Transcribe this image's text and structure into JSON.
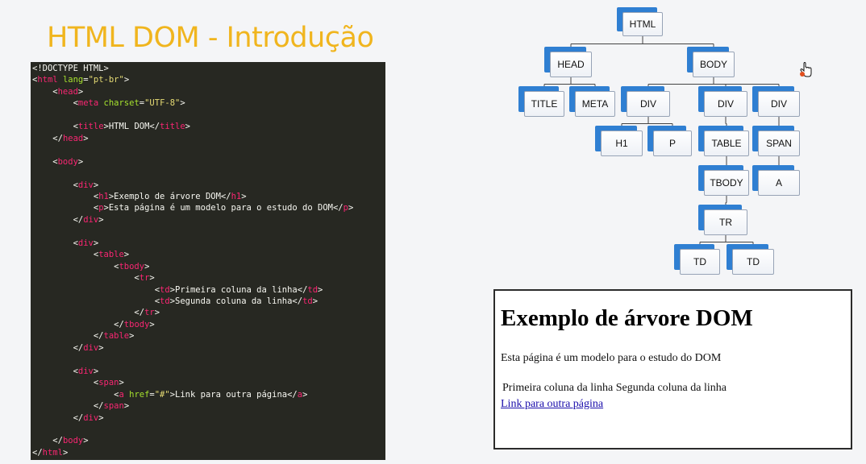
{
  "title": "HTML DOM - Introdução",
  "code": {
    "lines": [
      [
        {
          "c": "p",
          "t": "<!DOCTYPE HTML>"
        }
      ],
      [
        {
          "c": "p",
          "t": "<"
        },
        {
          "c": "t",
          "t": "html"
        },
        {
          "c": "a",
          "t": " lang"
        },
        {
          "c": "p",
          "t": "="
        },
        {
          "c": "s",
          "t": "\"pt-br\""
        },
        {
          "c": "p",
          "t": ">"
        }
      ],
      [
        {
          "c": "p",
          "t": "    <"
        },
        {
          "c": "t",
          "t": "head"
        },
        {
          "c": "p",
          "t": ">"
        }
      ],
      [
        {
          "c": "p",
          "t": "        <"
        },
        {
          "c": "t",
          "t": "meta"
        },
        {
          "c": "a",
          "t": " charset"
        },
        {
          "c": "p",
          "t": "="
        },
        {
          "c": "s",
          "t": "\"UTF-8\""
        },
        {
          "c": "p",
          "t": ">"
        }
      ],
      [],
      [
        {
          "c": "p",
          "t": "        <"
        },
        {
          "c": "t",
          "t": "title"
        },
        {
          "c": "p",
          "t": ">HTML DOM</"
        },
        {
          "c": "t",
          "t": "title"
        },
        {
          "c": "p",
          "t": ">"
        }
      ],
      [
        {
          "c": "p",
          "t": "    </"
        },
        {
          "c": "t",
          "t": "head"
        },
        {
          "c": "p",
          "t": ">"
        }
      ],
      [],
      [
        {
          "c": "p",
          "t": "    <"
        },
        {
          "c": "t",
          "t": "body"
        },
        {
          "c": "p",
          "t": ">"
        }
      ],
      [],
      [
        {
          "c": "p",
          "t": "        <"
        },
        {
          "c": "t",
          "t": "div"
        },
        {
          "c": "p",
          "t": ">"
        }
      ],
      [
        {
          "c": "p",
          "t": "            <"
        },
        {
          "c": "t",
          "t": "h1"
        },
        {
          "c": "p",
          "t": ">Exemplo de árvore DOM</"
        },
        {
          "c": "t",
          "t": "h1"
        },
        {
          "c": "p",
          "t": ">"
        }
      ],
      [
        {
          "c": "p",
          "t": "            <"
        },
        {
          "c": "t",
          "t": "p"
        },
        {
          "c": "p",
          "t": ">Esta página é um modelo para o estudo do DOM</"
        },
        {
          "c": "t",
          "t": "p"
        },
        {
          "c": "p",
          "t": ">"
        }
      ],
      [
        {
          "c": "p",
          "t": "        </"
        },
        {
          "c": "t",
          "t": "div"
        },
        {
          "c": "p",
          "t": ">"
        }
      ],
      [],
      [
        {
          "c": "p",
          "t": "        <"
        },
        {
          "c": "t",
          "t": "div"
        },
        {
          "c": "p",
          "t": ">"
        }
      ],
      [
        {
          "c": "p",
          "t": "            <"
        },
        {
          "c": "t",
          "t": "table"
        },
        {
          "c": "p",
          "t": ">"
        }
      ],
      [
        {
          "c": "p",
          "t": "                <"
        },
        {
          "c": "t",
          "t": "tbody"
        },
        {
          "c": "p",
          "t": ">"
        }
      ],
      [
        {
          "c": "p",
          "t": "                    <"
        },
        {
          "c": "t",
          "t": "tr"
        },
        {
          "c": "p",
          "t": ">"
        }
      ],
      [
        {
          "c": "p",
          "t": "                        <"
        },
        {
          "c": "t",
          "t": "td"
        },
        {
          "c": "p",
          "t": ">Primeira coluna da linha</"
        },
        {
          "c": "t",
          "t": "td"
        },
        {
          "c": "p",
          "t": ">"
        }
      ],
      [
        {
          "c": "p",
          "t": "                        <"
        },
        {
          "c": "t",
          "t": "td"
        },
        {
          "c": "p",
          "t": ">Segunda coluna da linha</"
        },
        {
          "c": "t",
          "t": "td"
        },
        {
          "c": "p",
          "t": ">"
        }
      ],
      [
        {
          "c": "p",
          "t": "                    </"
        },
        {
          "c": "t",
          "t": "tr"
        },
        {
          "c": "p",
          "t": ">"
        }
      ],
      [
        {
          "c": "p",
          "t": "                </"
        },
        {
          "c": "t",
          "t": "tbody"
        },
        {
          "c": "p",
          "t": ">"
        }
      ],
      [
        {
          "c": "p",
          "t": "            </"
        },
        {
          "c": "t",
          "t": "table"
        },
        {
          "c": "p",
          "t": ">"
        }
      ],
      [
        {
          "c": "p",
          "t": "        </"
        },
        {
          "c": "t",
          "t": "div"
        },
        {
          "c": "p",
          "t": ">"
        }
      ],
      [],
      [
        {
          "c": "p",
          "t": "        <"
        },
        {
          "c": "t",
          "t": "div"
        },
        {
          "c": "p",
          "t": ">"
        }
      ],
      [
        {
          "c": "p",
          "t": "            <"
        },
        {
          "c": "t",
          "t": "span"
        },
        {
          "c": "p",
          "t": ">"
        }
      ],
      [
        {
          "c": "p",
          "t": "                <"
        },
        {
          "c": "t",
          "t": "a"
        },
        {
          "c": "a",
          "t": " href"
        },
        {
          "c": "p",
          "t": "="
        },
        {
          "c": "s",
          "t": "\"#\""
        },
        {
          "c": "p",
          "t": ">Link para outra página</"
        },
        {
          "c": "t",
          "t": "a"
        },
        {
          "c": "p",
          "t": ">"
        }
      ],
      [
        {
          "c": "p",
          "t": "            </"
        },
        {
          "c": "t",
          "t": "span"
        },
        {
          "c": "p",
          "t": ">"
        }
      ],
      [
        {
          "c": "p",
          "t": "        </"
        },
        {
          "c": "t",
          "t": "div"
        },
        {
          "c": "p",
          "t": ">"
        }
      ],
      [],
      [
        {
          "c": "p",
          "t": "    </"
        },
        {
          "c": "t",
          "t": "body"
        },
        {
          "c": "p",
          "t": ">"
        }
      ],
      [
        {
          "c": "p",
          "t": "</"
        },
        {
          "c": "t",
          "t": "html"
        },
        {
          "c": "p",
          "t": ">"
        }
      ]
    ],
    "colors": {
      "background": "#272822",
      "tag": "#f92672",
      "attribute": "#a6e22e",
      "string": "#e6db74",
      "text": "#f8f8f2"
    }
  },
  "tree": {
    "nodes": {
      "html": "HTML",
      "head": "HEAD",
      "body": "BODY",
      "title": "TITLE",
      "meta": "META",
      "div1": "DIV",
      "div2": "DIV",
      "div3": "DIV",
      "h1": "H1",
      "p": "P",
      "table": "TABLE",
      "span": "SPAN",
      "tbody": "TBODY",
      "a": "A",
      "tr": "TR",
      "td1": "TD",
      "td2": "TD"
    },
    "edges": [
      [
        "html",
        "head"
      ],
      [
        "html",
        "body"
      ],
      [
        "head",
        "title"
      ],
      [
        "head",
        "meta"
      ],
      [
        "body",
        "div1"
      ],
      [
        "body",
        "div2"
      ],
      [
        "body",
        "div3"
      ],
      [
        "div1",
        "h1"
      ],
      [
        "div1",
        "p"
      ],
      [
        "div2",
        "table"
      ],
      [
        "table",
        "tbody"
      ],
      [
        "tbody",
        "tr"
      ],
      [
        "tr",
        "td1"
      ],
      [
        "tr",
        "td2"
      ],
      [
        "div3",
        "span"
      ],
      [
        "span",
        "a"
      ]
    ],
    "colors": {
      "node_shadow": "#2f7fd2",
      "node_border": "#97a3b6"
    }
  },
  "preview": {
    "h1": "Exemplo de árvore DOM",
    "paragraph": "Esta página é um modelo para o estudo do DOM",
    "table_row": "Primeira coluna da linha Segunda coluna da linha",
    "link": "Link para outra página"
  },
  "accent_color": "#f0b51e",
  "cursor_icon": "hand-pointer-icon"
}
